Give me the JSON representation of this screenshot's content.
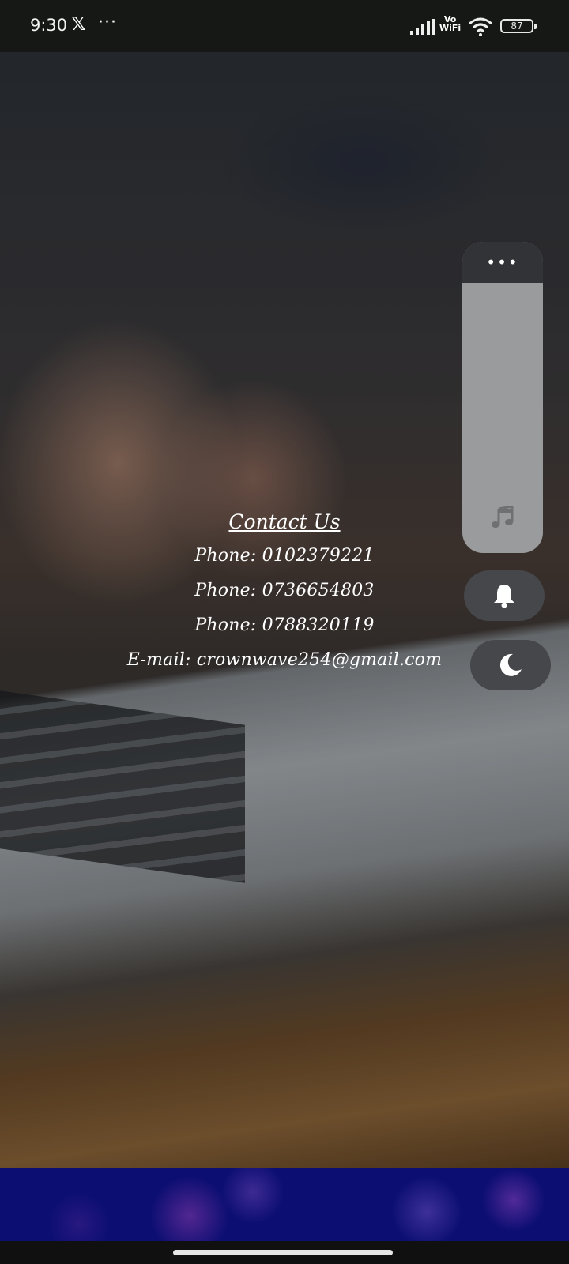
{
  "status_bar": {
    "time": "9:30",
    "x_app": "𝕏",
    "more": "···",
    "vowifi_top": "Vo",
    "vowifi_bottom": "WiFi",
    "battery": "87"
  },
  "contact": {
    "title": "Contact Us",
    "lines": [
      "Phone: 0102379221",
      "Phone: 0736654803",
      "Phone: 0788320119",
      "E-mail: crownwave254@gmail.com"
    ]
  },
  "side_panel": {
    "more": "•••",
    "icons": [
      "music-note-icon",
      "bell-icon",
      "moon-icon"
    ]
  },
  "colors": {
    "banner": "#0c0e72",
    "panel": "#9a9b9c",
    "panel_header": "#323336",
    "round_button": "#46474a"
  }
}
